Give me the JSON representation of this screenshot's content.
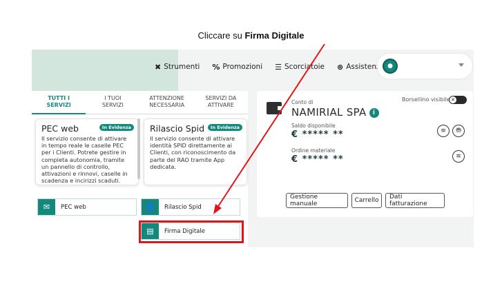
{
  "caption": {
    "prefix": "Cliccare su ",
    "bold": "Firma Digitale"
  },
  "topnav": {
    "items": [
      {
        "icon": "tools-icon",
        "label": "Strumenti"
      },
      {
        "icon": "percent-icon",
        "label": "Promozioni"
      },
      {
        "icon": "menu-icon",
        "label": "Scorciatoie"
      },
      {
        "icon": "help-icon",
        "label": "Assistenza"
      }
    ]
  },
  "tabs": [
    {
      "line1": "TUTTI I",
      "line2": "SERVIZI"
    },
    {
      "line1": "I TUOI",
      "line2": "SERVIZI"
    },
    {
      "line1": "ATTENZIONE",
      "line2": "NECESSARIA"
    },
    {
      "line1": "SERVIZI DA",
      "line2": "ATTIVARE"
    }
  ],
  "cards": [
    {
      "title": "PEC web",
      "badge": "In Evidenza",
      "desc": "Il servizio consente di attivare in tempo reale le caselle PEC per i Clienti. Potrete gestire in completa autonomia, tramite un pannello di controllo, attivazioni e rinnovi, caselle in scadenza e incirizzi scaduti."
    },
    {
      "title": "Rilascio Spid",
      "badge": "In Evidenza",
      "desc": "Il servizio consente di attivare identità SPID direttamente ai Clienti, con riconoscimento da parte del RAO tramite App dedicata."
    }
  ],
  "service_buttons": [
    {
      "label": "PEC web",
      "icon": "envelope-icon"
    },
    {
      "label": "Rilascio Spid",
      "icon": "add-user-icon"
    },
    {
      "label": "Firma Digitale",
      "icon": "id-card-icon"
    }
  ],
  "wallet": {
    "account_label": "Conto di",
    "company": "NAMIRIAL SPA",
    "toggle_label": "Borsellino visibile",
    "balance_label": "Saldo disponibile",
    "balance_value": "€ ***** **",
    "order_label": "Ordine materiale",
    "order_value": "€ ***** **",
    "buttons": [
      "Gestione manuale",
      "Carrello",
      "Dati fatturazione"
    ]
  },
  "colors": {
    "accent": "#15887d",
    "highlight": "#e0141b"
  }
}
